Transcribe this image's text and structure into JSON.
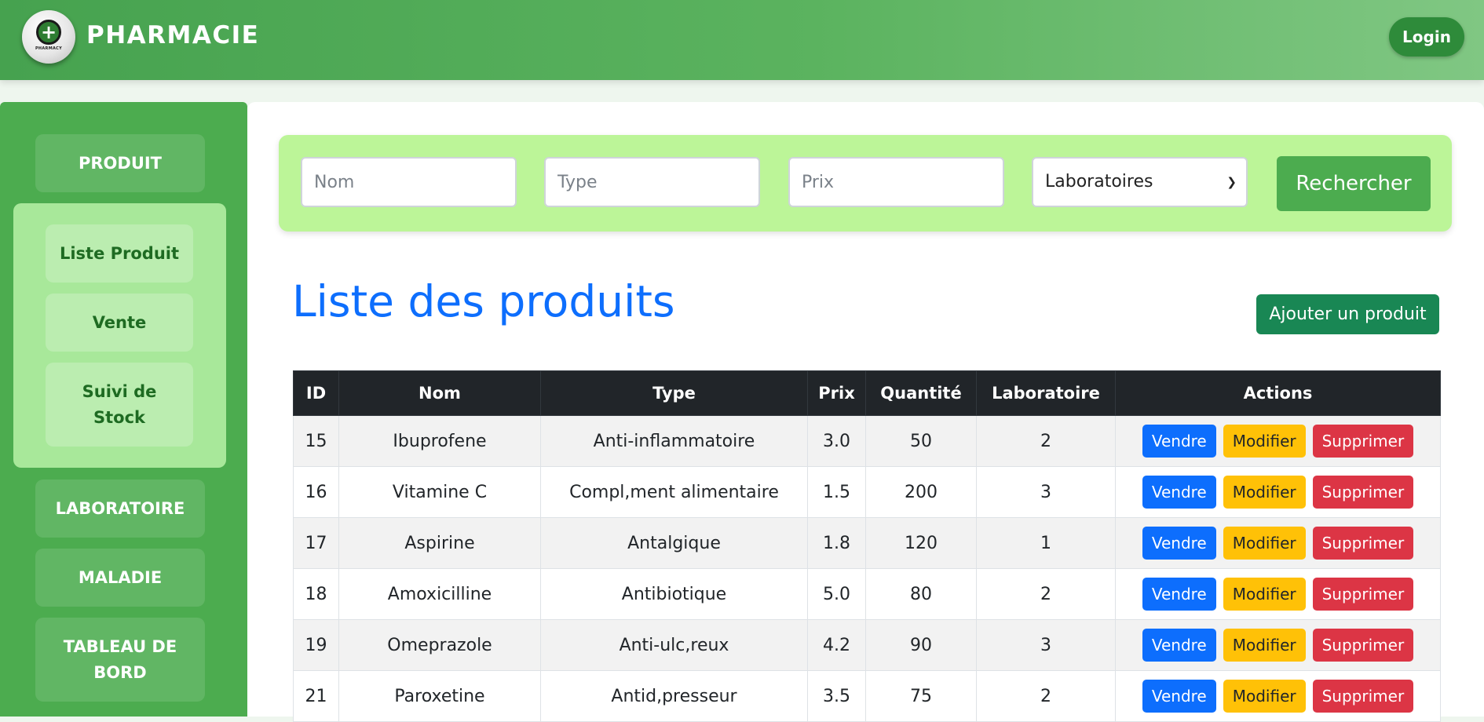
{
  "header": {
    "brand": "PHARMACIE",
    "logo_text": "PHARMACY",
    "login_label": "Login"
  },
  "sidebar": {
    "items": [
      {
        "label": "PRODUIT"
      },
      {
        "label": "LABORATOIRE"
      },
      {
        "label": "MALADIE"
      },
      {
        "label": "TABLEAU DE BORD"
      }
    ],
    "submenu": [
      {
        "label": "Liste Produit"
      },
      {
        "label": "Vente"
      },
      {
        "label": "Suivi de Stock"
      }
    ]
  },
  "search": {
    "nom_placeholder": "Nom",
    "type_placeholder": "Type",
    "prix_placeholder": "Prix",
    "laboratoire_selected": "Laboratoires",
    "button_label": "Rechercher"
  },
  "main": {
    "title": "Liste des produits",
    "add_button": "Ajouter un produit"
  },
  "table": {
    "headers": [
      "ID",
      "Nom",
      "Type",
      "Prix",
      "Quantité",
      "Laboratoire",
      "Actions"
    ],
    "action_labels": {
      "sell": "Vendre",
      "edit": "Modifier",
      "delete": "Supprimer"
    },
    "rows": [
      {
        "id": "15",
        "nom": "Ibuprofene",
        "type": "Anti-inflammatoire",
        "prix": "3.0",
        "quantite": "50",
        "laboratoire": "2"
      },
      {
        "id": "16",
        "nom": "Vitamine C",
        "type": "Compl,ment alimentaire",
        "prix": "1.5",
        "quantite": "200",
        "laboratoire": "3"
      },
      {
        "id": "17",
        "nom": "Aspirine",
        "type": "Antalgique",
        "prix": "1.8",
        "quantite": "120",
        "laboratoire": "1"
      },
      {
        "id": "18",
        "nom": "Amoxicilline",
        "type": "Antibiotique",
        "prix": "5.0",
        "quantite": "80",
        "laboratoire": "2"
      },
      {
        "id": "19",
        "nom": "Omeprazole",
        "type": "Anti-ulc,reux",
        "prix": "4.2",
        "quantite": "90",
        "laboratoire": "3"
      },
      {
        "id": "21",
        "nom": "Paroxetine",
        "type": "Antid,presseur",
        "prix": "3.5",
        "quantite": "75",
        "laboratoire": "2"
      }
    ]
  },
  "colors": {
    "header_green": "#46a24f",
    "sidebar_green": "#4cac4f",
    "submenu_green": "#a8e89a",
    "search_panel": "#bcf598",
    "title_blue": "#0d6efd",
    "add_button": "#198754",
    "sell": "#0d6efd",
    "edit": "#ffc107",
    "delete": "#dc3545"
  }
}
